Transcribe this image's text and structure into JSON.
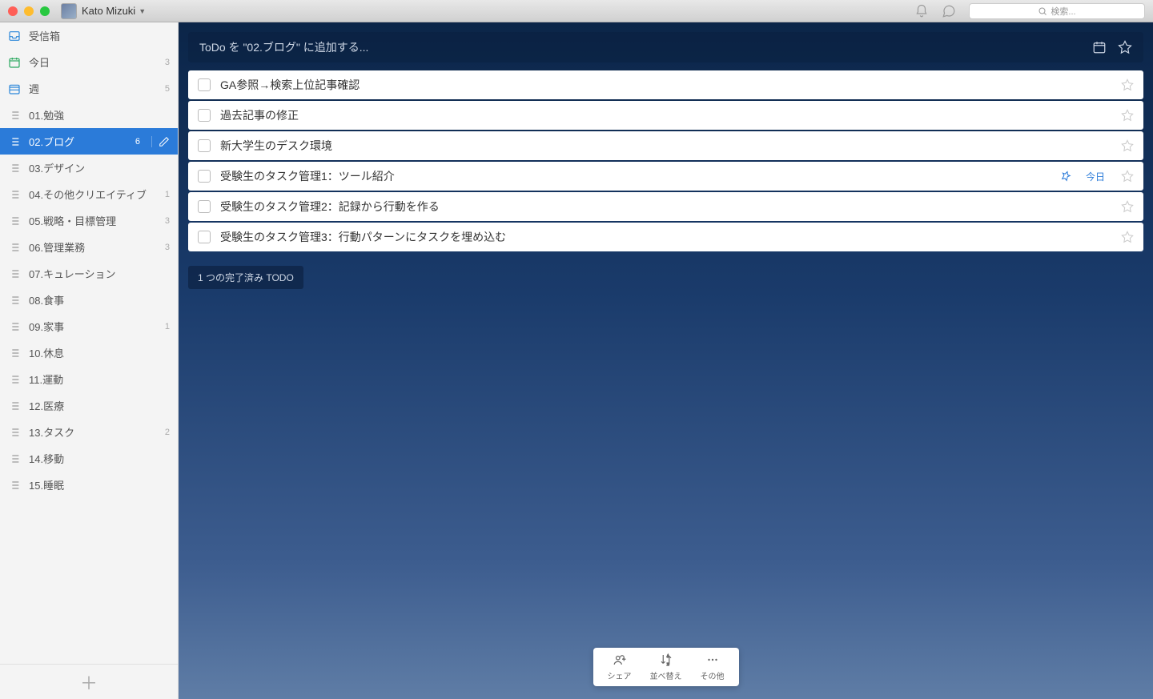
{
  "titlebar": {
    "username": "Kato Mizuki",
    "search_placeholder": "検索..."
  },
  "sidebar": {
    "smart": [
      {
        "icon": "inbox",
        "label": "受信箱",
        "count": ""
      },
      {
        "icon": "today",
        "label": "今日",
        "count": "3"
      },
      {
        "icon": "week",
        "label": "週",
        "count": "5"
      }
    ],
    "lists": [
      {
        "label": "01.勉強",
        "count": ""
      },
      {
        "label": "02.ブログ",
        "count": "6",
        "selected": true
      },
      {
        "label": "03.デザイン",
        "count": ""
      },
      {
        "label": "04.その他クリエイティブ",
        "count": "1"
      },
      {
        "label": "05.戦略・目標管理",
        "count": "3"
      },
      {
        "label": "06.管理業務",
        "count": "3"
      },
      {
        "label": "07.キュレーション",
        "count": ""
      },
      {
        "label": "08.食事",
        "count": ""
      },
      {
        "label": "09.家事",
        "count": "1"
      },
      {
        "label": "10.休息",
        "count": ""
      },
      {
        "label": "11.運動",
        "count": ""
      },
      {
        "label": "12.医療",
        "count": ""
      },
      {
        "label": "13.タスク",
        "count": "2"
      },
      {
        "label": "14.移動",
        "count": ""
      },
      {
        "label": "15.睡眠",
        "count": ""
      }
    ]
  },
  "main": {
    "add_placeholder": "ToDo を \"02.ブログ\" に追加する...",
    "todos": [
      {
        "title": "GA参照→検索上位記事確認",
        "due": "",
        "pinned": false
      },
      {
        "title": "過去記事の修正",
        "due": "",
        "pinned": false
      },
      {
        "title": "新大学生のデスク環境",
        "due": "",
        "pinned": false
      },
      {
        "title": "受験生のタスク管理1：ツール紹介",
        "due": "今日",
        "pinned": true
      },
      {
        "title": "受験生のタスク管理2：記録から行動を作る",
        "due": "",
        "pinned": false
      },
      {
        "title": "受験生のタスク管理3：行動パターンにタスクを埋め込む",
        "due": "",
        "pinned": false
      }
    ],
    "completed_label": "1 つの完了済み TODO"
  },
  "bottombar": {
    "share": "シェア",
    "sort": "並べ替え",
    "more": "その他"
  }
}
